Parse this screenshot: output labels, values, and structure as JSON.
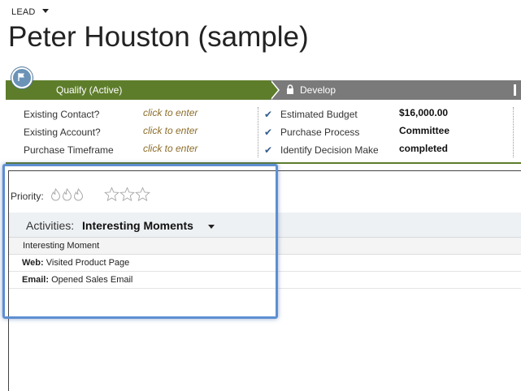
{
  "header": {
    "entity_type": "LEAD",
    "record_name": "Peter Houston (sample)"
  },
  "stages": {
    "active_label": "Qualify (Active)",
    "next_label": "Develop",
    "active_color": "#5e7d2b",
    "inactive_color": "#7a7a7a"
  },
  "qualify_fields": [
    {
      "label": "Existing Contact?",
      "value": "click to enter"
    },
    {
      "label": "Existing Account?",
      "value": "click to enter"
    },
    {
      "label": "Purchase Timeframe",
      "value": "click to enter"
    }
  ],
  "develop_fields": [
    {
      "label": "Estimated Budget",
      "value": "$16,000.00"
    },
    {
      "label": "Purchase Process",
      "value": "Committee"
    },
    {
      "label": "Identify Decision Make",
      "value": "completed"
    }
  ],
  "priority": {
    "label": "Priority:",
    "flames": 3,
    "stars": 3
  },
  "activities": {
    "label": "Activities:",
    "selected": "Interesting Moments",
    "column_header": "Interesting Moment",
    "rows": [
      {
        "type": "Web:",
        "text": "Visited Product Page"
      },
      {
        "type": "Email:",
        "text": "Opened Sales Email"
      }
    ]
  },
  "highlight_color": "#5d8fd1"
}
